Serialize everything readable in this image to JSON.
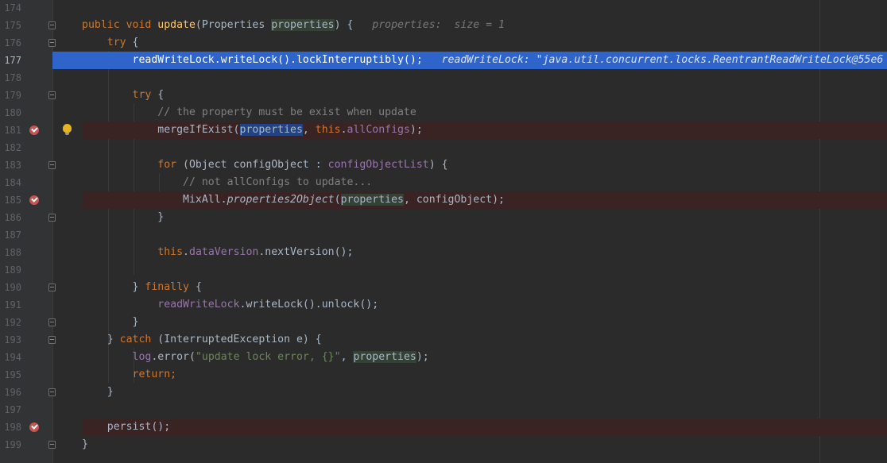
{
  "editor": {
    "lines": [
      {
        "n": "174",
        "tokens": []
      },
      {
        "n": "175",
        "tokens": [
          {
            "t": "public void ",
            "c": "kw"
          },
          {
            "t": "update",
            "c": "fn"
          },
          {
            "t": "(Properties ",
            "c": "plain"
          },
          {
            "t": "properties",
            "c": "hl"
          },
          {
            "t": ") {",
            "c": "plain"
          },
          {
            "t": "   properties:  size = 1",
            "c": "hint"
          }
        ]
      },
      {
        "n": "176",
        "tokens": [
          {
            "t": "    ",
            "c": "plain"
          },
          {
            "t": "try ",
            "c": "kw"
          },
          {
            "t": "{",
            "c": "plain"
          }
        ]
      },
      {
        "n": "177",
        "tokens": [
          {
            "t": "        ",
            "c": "plain"
          },
          {
            "t": "readWriteLock",
            "c": "fld"
          },
          {
            "t": ".writeLock().lockInterruptibly();",
            "c": "plain"
          },
          {
            "t": "   readWriteLock: \"java.util.concurrent.locks.ReentrantReadWriteLock@55e6",
            "c": "hint"
          }
        ]
      },
      {
        "n": "178",
        "tokens": []
      },
      {
        "n": "179",
        "tokens": [
          {
            "t": "        ",
            "c": "plain"
          },
          {
            "t": "try ",
            "c": "kw"
          },
          {
            "t": "{",
            "c": "plain"
          }
        ]
      },
      {
        "n": "180",
        "tokens": [
          {
            "t": "            ",
            "c": "plain"
          },
          {
            "t": "// the property must be exist when update",
            "c": "cm"
          }
        ]
      },
      {
        "n": "181",
        "tokens": [
          {
            "t": "            mergeIfExist(",
            "c": "plain"
          },
          {
            "t": "properties",
            "c": "sel"
          },
          {
            "t": ", ",
            "c": "plain"
          },
          {
            "t": "this",
            "c": "kw"
          },
          {
            "t": ".",
            "c": "plain"
          },
          {
            "t": "allConfigs",
            "c": "fld"
          },
          {
            "t": ");",
            "c": "plain"
          }
        ]
      },
      {
        "n": "182",
        "tokens": []
      },
      {
        "n": "183",
        "tokens": [
          {
            "t": "            ",
            "c": "plain"
          },
          {
            "t": "for ",
            "c": "kw"
          },
          {
            "t": "(Object configObject : ",
            "c": "plain"
          },
          {
            "t": "configObjectList",
            "c": "fld"
          },
          {
            "t": ") {",
            "c": "plain"
          }
        ]
      },
      {
        "n": "184",
        "tokens": [
          {
            "t": "                ",
            "c": "plain"
          },
          {
            "t": "// not allConfigs to update...",
            "c": "cm"
          }
        ]
      },
      {
        "n": "185",
        "tokens": [
          {
            "t": "                MixAll.",
            "c": "plain"
          },
          {
            "t": "properties2Object",
            "c": "it"
          },
          {
            "t": "(",
            "c": "plain"
          },
          {
            "t": "properties",
            "c": "hl"
          },
          {
            "t": ", configObject);",
            "c": "plain"
          }
        ]
      },
      {
        "n": "186",
        "tokens": [
          {
            "t": "            }",
            "c": "plain"
          }
        ]
      },
      {
        "n": "187",
        "tokens": []
      },
      {
        "n": "188",
        "tokens": [
          {
            "t": "            ",
            "c": "plain"
          },
          {
            "t": "this",
            "c": "kw"
          },
          {
            "t": ".",
            "c": "plain"
          },
          {
            "t": "dataVersion",
            "c": "fld"
          },
          {
            "t": ".nextVersion();",
            "c": "plain"
          }
        ]
      },
      {
        "n": "189",
        "tokens": []
      },
      {
        "n": "190",
        "tokens": [
          {
            "t": "        } ",
            "c": "plain"
          },
          {
            "t": "finally ",
            "c": "kw"
          },
          {
            "t": "{",
            "c": "plain"
          }
        ]
      },
      {
        "n": "191",
        "tokens": [
          {
            "t": "            ",
            "c": "plain"
          },
          {
            "t": "readWriteLock",
            "c": "fld"
          },
          {
            "t": ".writeLock().unlock();",
            "c": "plain"
          }
        ]
      },
      {
        "n": "192",
        "tokens": [
          {
            "t": "        }",
            "c": "plain"
          }
        ]
      },
      {
        "n": "193",
        "tokens": [
          {
            "t": "    } ",
            "c": "plain"
          },
          {
            "t": "catch ",
            "c": "kw"
          },
          {
            "t": "(InterruptedException e) {",
            "c": "plain"
          }
        ]
      },
      {
        "n": "194",
        "tokens": [
          {
            "t": "        ",
            "c": "plain"
          },
          {
            "t": "log",
            "c": "fld"
          },
          {
            "t": ".error(",
            "c": "plain"
          },
          {
            "t": "\"update lock error, {}\"",
            "c": "str"
          },
          {
            "t": ", ",
            "c": "plain"
          },
          {
            "t": "properties",
            "c": "hl"
          },
          {
            "t": ");",
            "c": "plain"
          }
        ]
      },
      {
        "n": "195",
        "tokens": [
          {
            "t": "        ",
            "c": "plain"
          },
          {
            "t": "return;",
            "c": "kw"
          }
        ]
      },
      {
        "n": "196",
        "tokens": [
          {
            "t": "    }",
            "c": "plain"
          }
        ]
      },
      {
        "n": "197",
        "tokens": []
      },
      {
        "n": "198",
        "tokens": [
          {
            "t": "    persist();",
            "c": "plain"
          }
        ]
      },
      {
        "n": "199",
        "tokens": [
          {
            "t": "}",
            "c": "plain"
          }
        ]
      }
    ],
    "breakpoint_lines": [
      "181",
      "185",
      "198"
    ],
    "current_execution_line": "177",
    "intention_bulb_line": "181",
    "fold_down_lines": [
      "175",
      "176",
      "179",
      "183",
      "190",
      "193"
    ],
    "fold_up_lines": [
      "186",
      "192",
      "196",
      "199"
    ],
    "colors": {
      "background": "#2b2b2b",
      "gutter": "#313335",
      "execution_line": "#2f65ca",
      "breakpoint_line": "#3a2323",
      "breakpoint_icon": "#c75450",
      "keyword": "#cc7832",
      "method": "#ffc66d",
      "field": "#9876aa",
      "comment": "#808080",
      "string": "#6a8759"
    },
    "icons": {
      "breakpoint": "breakpoint-icon",
      "bulb": "intention-bulb-icon",
      "fold": "fold-marker-icon"
    }
  }
}
